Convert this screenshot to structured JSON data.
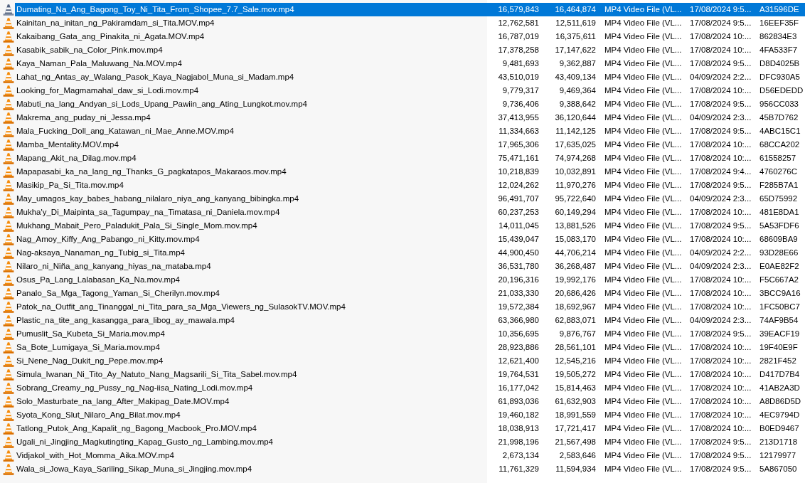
{
  "file_list": {
    "rows": [
      {
        "selected": true,
        "cells": [
          "Dumating_Na_Ang_Bagong_Toy_Ni_Tita_From_Shopee_7.7_Sale.mov.mp4",
          "16,579,843",
          "16,464,874",
          "MP4 Video File (VL...",
          "17/08/2024 9:5...",
          "A31596DE"
        ]
      },
      {
        "selected": false,
        "cells": [
          "Kainitan_na_initan_ng_Pakiramdam_si_Tita.MOV.mp4",
          "12,762,581",
          "12,511,619",
          "MP4 Video File (VL...",
          "17/08/2024 9:5...",
          "16EEF35F"
        ]
      },
      {
        "selected": false,
        "cells": [
          "Kakaibang_Gata_ang_Pinakita_ni_Agata.MOV.mp4",
          "16,787,019",
          "16,375,611",
          "MP4 Video File (VL...",
          "17/08/2024 10:...",
          "862834E3"
        ]
      },
      {
        "selected": false,
        "cells": [
          "Kasabik_sabik_na_Color_Pink.mov.mp4",
          "17,378,258",
          "17,147,622",
          "MP4 Video File (VL...",
          "17/08/2024 10:...",
          "4FA533F7"
        ]
      },
      {
        "selected": false,
        "cells": [
          "Kaya_Naman_Pala_Maluwang_Na.MOV.mp4",
          "9,481,693",
          "9,362,887",
          "MP4 Video File (VL...",
          "17/08/2024 9:5...",
          "D8D4025B"
        ]
      },
      {
        "selected": false,
        "cells": [
          "Lahat_ng_Antas_ay_Walang_Pasok_Kaya_Nagjabol_Muna_si_Madam.mp4",
          "43,510,019",
          "43,409,134",
          "MP4 Video File (VL...",
          "04/09/2024 2:2...",
          "DFC930A5"
        ]
      },
      {
        "selected": false,
        "cells": [
          "Looking_for_Magmamahal_daw_si_Lodi.mov.mp4",
          "9,779,317",
          "9,469,364",
          "MP4 Video File (VL...",
          "17/08/2024 10:...",
          "D56EDEDD"
        ]
      },
      {
        "selected": false,
        "cells": [
          "Mabuti_na_lang_Andyan_si_Lods_Upang_Pawiin_ang_Ating_Lungkot.mov.mp4",
          "9,736,406",
          "9,388,642",
          "MP4 Video File (VL...",
          "17/08/2024 9:5...",
          "956CC033"
        ]
      },
      {
        "selected": false,
        "cells": [
          "Makrema_ang_puday_ni_Jessa.mp4",
          "37,413,955",
          "36,120,644",
          "MP4 Video File (VL...",
          "04/09/2024 2:3...",
          "45B7D762"
        ]
      },
      {
        "selected": false,
        "cells": [
          "Mala_Fucking_Doll_ang_Katawan_ni_Mae_Anne.MOV.mp4",
          "11,334,663",
          "11,142,125",
          "MP4 Video File (VL...",
          "17/08/2024 9:5...",
          "4ABC15C1"
        ]
      },
      {
        "selected": false,
        "cells": [
          "Mamba_Mentality.MOV.mp4",
          "17,965,306",
          "17,635,025",
          "MP4 Video File (VL...",
          "17/08/2024 10:...",
          "68CCA202"
        ]
      },
      {
        "selected": false,
        "cells": [
          "Mapang_Akit_na_Dilag.mov.mp4",
          "75,471,161",
          "74,974,268",
          "MP4 Video File (VL...",
          "17/08/2024 10:...",
          "61558257"
        ]
      },
      {
        "selected": false,
        "cells": [
          "Mapapasabi_ka_na_lang_ng_Thanks_G_pagkatapos_Makaraos.mov.mp4",
          "10,218,839",
          "10,032,891",
          "MP4 Video File (VL...",
          "17/08/2024 9:4...",
          "4760276C"
        ]
      },
      {
        "selected": false,
        "cells": [
          "Masikip_Pa_Si_Tita.mov.mp4",
          "12,024,262",
          "11,970,276",
          "MP4 Video File (VL...",
          "17/08/2024 9:5...",
          "F285B7A1"
        ]
      },
      {
        "selected": false,
        "cells": [
          "May_umagos_kay_babes_habang_nilalaro_niya_ang_kanyang_bibingka.mp4",
          "96,491,707",
          "95,722,640",
          "MP4 Video File (VL...",
          "04/09/2024 2:3...",
          "65D75992"
        ]
      },
      {
        "selected": false,
        "cells": [
          "Mukha'y_Di_Maipinta_sa_Tagumpay_na_Timatasa_ni_Daniela.mov.mp4",
          "60,237,253",
          "60,149,294",
          "MP4 Video File (VL...",
          "17/08/2024 10:...",
          "481E8DA1"
        ]
      },
      {
        "selected": false,
        "cells": [
          "Mukhang_Mabait_Pero_Paladukit_Pala_Si_Single_Mom.mov.mp4",
          "14,011,045",
          "13,881,526",
          "MP4 Video File (VL...",
          "17/08/2024 9:5...",
          "5A53FDF6"
        ]
      },
      {
        "selected": false,
        "cells": [
          "Nag_Amoy_Kiffy_Ang_Pabango_ni_Kitty.mov.mp4",
          "15,439,047",
          "15,083,170",
          "MP4 Video File (VL...",
          "17/08/2024 10:...",
          "68609BA9"
        ]
      },
      {
        "selected": false,
        "cells": [
          "Nag-aksaya_Nanaman_ng_Tubig_si_Tita.mp4",
          "44,900,450",
          "44,706,214",
          "MP4 Video File (VL...",
          "04/09/2024 2:2...",
          "93D28E66"
        ]
      },
      {
        "selected": false,
        "cells": [
          "Nilaro_ni_Niña_ang_kanyang_hiyas_na_mataba.mp4",
          "36,531,780",
          "36,268,487",
          "MP4 Video File (VL...",
          "04/09/2024 2:3...",
          "E0AE82F2"
        ]
      },
      {
        "selected": false,
        "cells": [
          "Osus_Pa_Lang_Lalabasan_Ka_Na.mov.mp4",
          "20,196,316",
          "19,992,176",
          "MP4 Video File (VL...",
          "17/08/2024 10:...",
          "F5C667A2"
        ]
      },
      {
        "selected": false,
        "cells": [
          "Panalo_Sa_Mga_Tagong_Yaman_Si_Cherilyn.mov.mp4",
          "21,033,330",
          "20,686,426",
          "MP4 Video File (VL...",
          "17/08/2024 10:...",
          "3BCC9A16"
        ]
      },
      {
        "selected": false,
        "cells": [
          "Patok_na_Outfit_ang_Tinanggal_ni_Tita_para_sa_Mga_Viewers_ng_SulasokTV.MOV.mp4",
          "19,572,384",
          "18,692,967",
          "MP4 Video File (VL...",
          "17/08/2024 10:...",
          "1FC50BC7"
        ]
      },
      {
        "selected": false,
        "cells": [
          "Plastic_na_tite_ang_kasangga_para_libog_ay_mawala.mp4",
          "63,366,980",
          "62,883,071",
          "MP4 Video File (VL...",
          "04/09/2024 2:3...",
          "74AF9B54"
        ]
      },
      {
        "selected": false,
        "cells": [
          "Pumuslit_Sa_Kubeta_Si_Maria.mov.mp4",
          "10,356,695",
          "9,876,767",
          "MP4 Video File (VL...",
          "17/08/2024 9:5...",
          "39EACF19"
        ]
      },
      {
        "selected": false,
        "cells": [
          "Sa_Bote_Lumigaya_Si_Maria.mov.mp4",
          "28,923,886",
          "28,561,101",
          "MP4 Video File (VL...",
          "17/08/2024 10:...",
          "19F40E9F"
        ]
      },
      {
        "selected": false,
        "cells": [
          "Si_Nene_Nag_Dukit_ng_Pepe.mov.mp4",
          "12,621,400",
          "12,545,216",
          "MP4 Video File (VL...",
          "17/08/2024 10:...",
          "2821F452"
        ]
      },
      {
        "selected": false,
        "cells": [
          "Simula_Iwanan_Ni_Tito_Ay_Natuto_Nang_Magsarili_Si_Tita_Sabel.mov.mp4",
          "19,764,531",
          "19,505,272",
          "MP4 Video File (VL...",
          "17/08/2024 10:...",
          "D417D7B4"
        ]
      },
      {
        "selected": false,
        "cells": [
          "Sobrang_Creamy_ng_Pussy_ng_Nag-iisa_Nating_Lodi.mov.mp4",
          "16,177,042",
          "15,814,463",
          "MP4 Video File (VL...",
          "17/08/2024 10:...",
          "41AB2A3D"
        ]
      },
      {
        "selected": false,
        "cells": [
          "Solo_Masturbate_na_lang_After_Makipag_Date.MOV.mp4",
          "61,893,036",
          "61,632,903",
          "MP4 Video File (VL...",
          "17/08/2024 10:...",
          "A8D86D5D"
        ]
      },
      {
        "selected": false,
        "cells": [
          "Syota_Kong_Slut_Nilaro_Ang_Bilat.mov.mp4",
          "19,460,182",
          "18,991,559",
          "MP4 Video File (VL...",
          "17/08/2024 10:...",
          "4EC9794D"
        ]
      },
      {
        "selected": false,
        "cells": [
          "Tatlong_Putok_Ang_Kapalit_ng_Bagong_Macbook_Pro.MOV.mp4",
          "18,038,913",
          "17,721,417",
          "MP4 Video File (VL...",
          "17/08/2024 10:...",
          "B0ED9467"
        ]
      },
      {
        "selected": false,
        "cells": [
          "Ugali_ni_Jingjing_Magkutingting_Kapag_Gusto_ng_Lambing.mov.mp4",
          "21,998,196",
          "21,567,498",
          "MP4 Video File (VL...",
          "17/08/2024 9:5...",
          "213D1718"
        ]
      },
      {
        "selected": false,
        "cells": [
          "Vidjakol_with_Hot_Momma_Aika.MOV.mp4",
          "2,673,134",
          "2,583,646",
          "MP4 Video File (VL...",
          "17/08/2024 9:5...",
          "12179977"
        ]
      },
      {
        "selected": false,
        "cells": [
          "Wala_si_Jowa_Kaya_Sariling_Sikap_Muna_si_Jingjing.mov.mp4",
          "11,761,329",
          "11,594,934",
          "MP4 Video File (VL...",
          "17/08/2024 9:5...",
          "5A867050"
        ]
      }
    ]
  }
}
